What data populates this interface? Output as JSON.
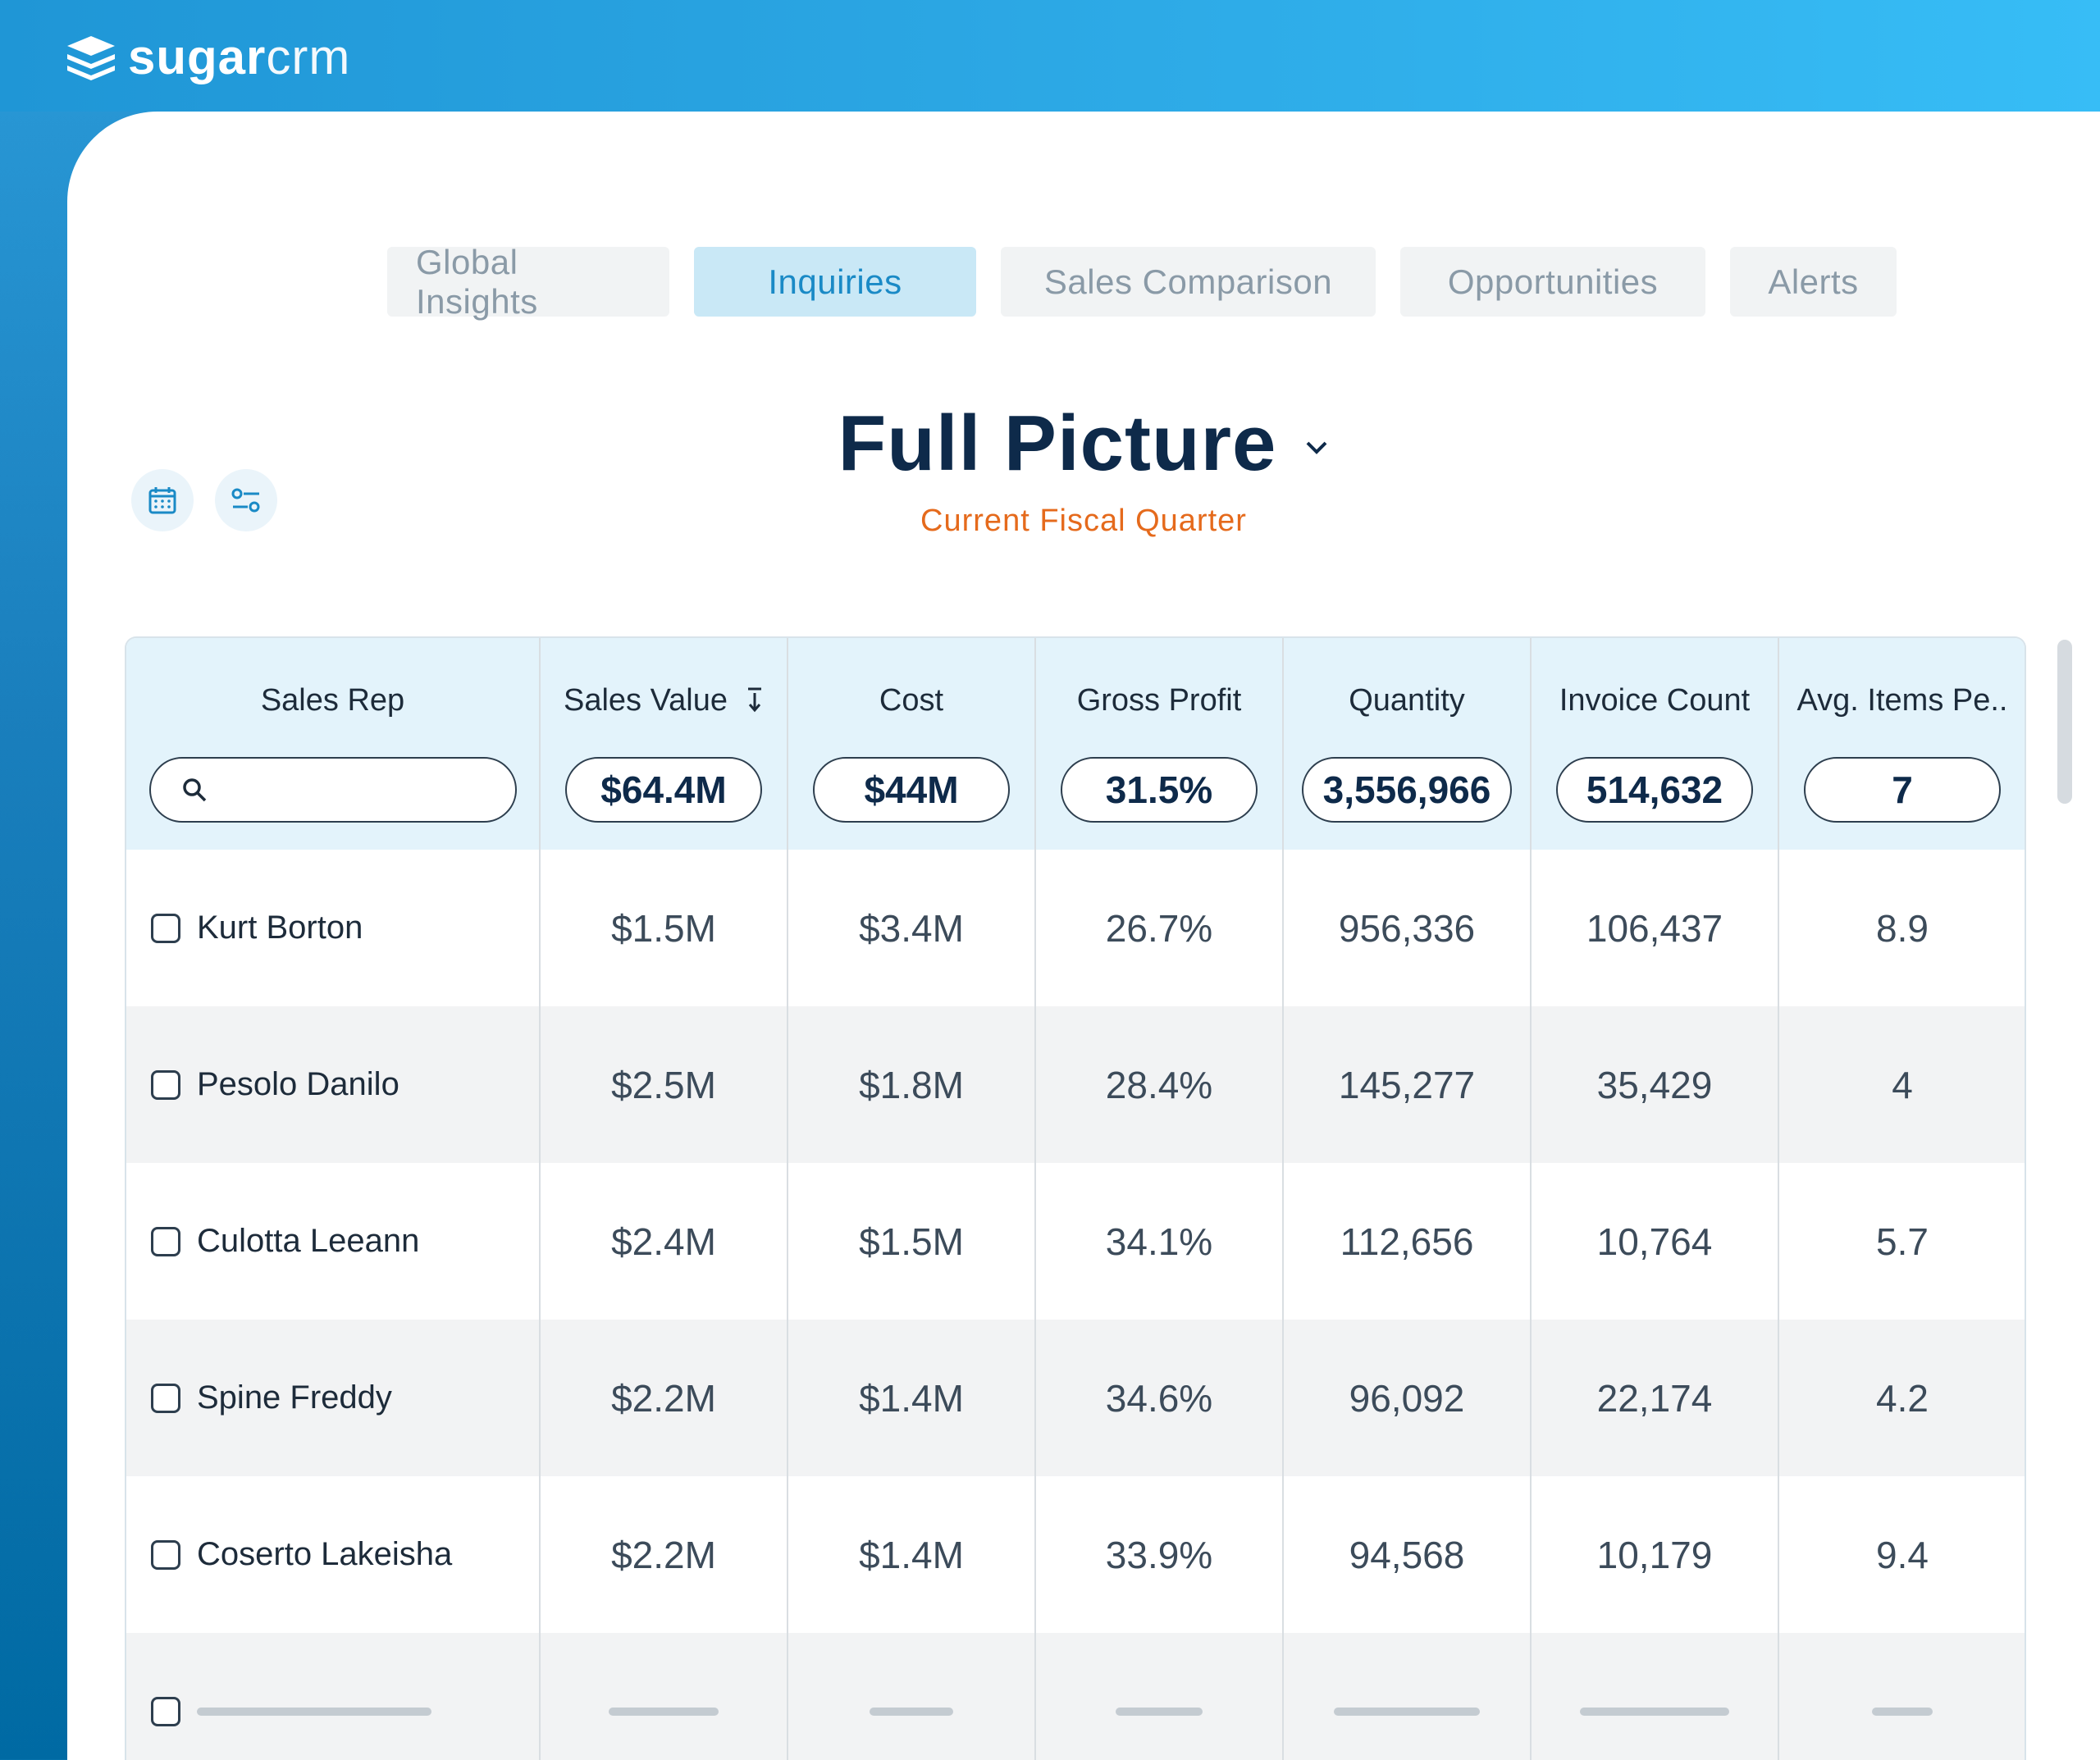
{
  "brand": {
    "bold": "sugar",
    "light": "crm"
  },
  "tabs": [
    {
      "label": "Global Insights",
      "active": false
    },
    {
      "label": "Inquiries",
      "active": true
    },
    {
      "label": "Sales Comparison",
      "active": false
    },
    {
      "label": "Opportunities",
      "active": false
    },
    {
      "label": "Alerts",
      "active": false
    }
  ],
  "header": {
    "title": "Full Picture",
    "subtitle": "Current Fiscal Quarter"
  },
  "toolbar": {
    "calendar_icon": "calendar-icon",
    "filter_icon": "filter-settings-icon"
  },
  "table": {
    "columns": [
      {
        "label": "Sales Rep",
        "total": ""
      },
      {
        "label": "Sales Value",
        "total": "$64.4M",
        "sorted": "descending"
      },
      {
        "label": "Cost",
        "total": "$44M"
      },
      {
        "label": "Gross Profit",
        "total": "31.5%"
      },
      {
        "label": "Quantity",
        "total": "3,556,966"
      },
      {
        "label": "Invoice Count",
        "total": "514,632"
      },
      {
        "label": "Avg. Items Pe..",
        "total": "7"
      }
    ],
    "rows": [
      {
        "name": "Kurt Borton",
        "sales_value": "$1.5M",
        "cost": "$3.4M",
        "gross_profit": "26.7%",
        "quantity": "956,336",
        "invoice_count": "106,437",
        "avg_items": "8.9"
      },
      {
        "name": "Pesolo Danilo",
        "sales_value": "$2.5M",
        "cost": "$1.8M",
        "gross_profit": "28.4%",
        "quantity": "145,277",
        "invoice_count": "35,429",
        "avg_items": "4"
      },
      {
        "name": "Culotta Leeann",
        "sales_value": "$2.4M",
        "cost": "$1.5M",
        "gross_profit": "34.1%",
        "quantity": "112,656",
        "invoice_count": "10,764",
        "avg_items": "5.7"
      },
      {
        "name": "Spine Freddy",
        "sales_value": "$2.2M",
        "cost": "$1.4M",
        "gross_profit": "34.6%",
        "quantity": "96,092",
        "invoice_count": "22,174",
        "avg_items": "4.2"
      },
      {
        "name": "Coserto Lakeisha",
        "sales_value": "$2.2M",
        "cost": "$1.4M",
        "gross_profit": "33.9%",
        "quantity": "94,568",
        "invoice_count": "10,179",
        "avg_items": "9.4"
      }
    ]
  },
  "colors": {
    "accent": "#1a8ac6",
    "title": "#0e2a4a",
    "subtitle": "#e56a1c",
    "header_bg": "#e3f3fb",
    "topbar": "#2ba6e3"
  }
}
